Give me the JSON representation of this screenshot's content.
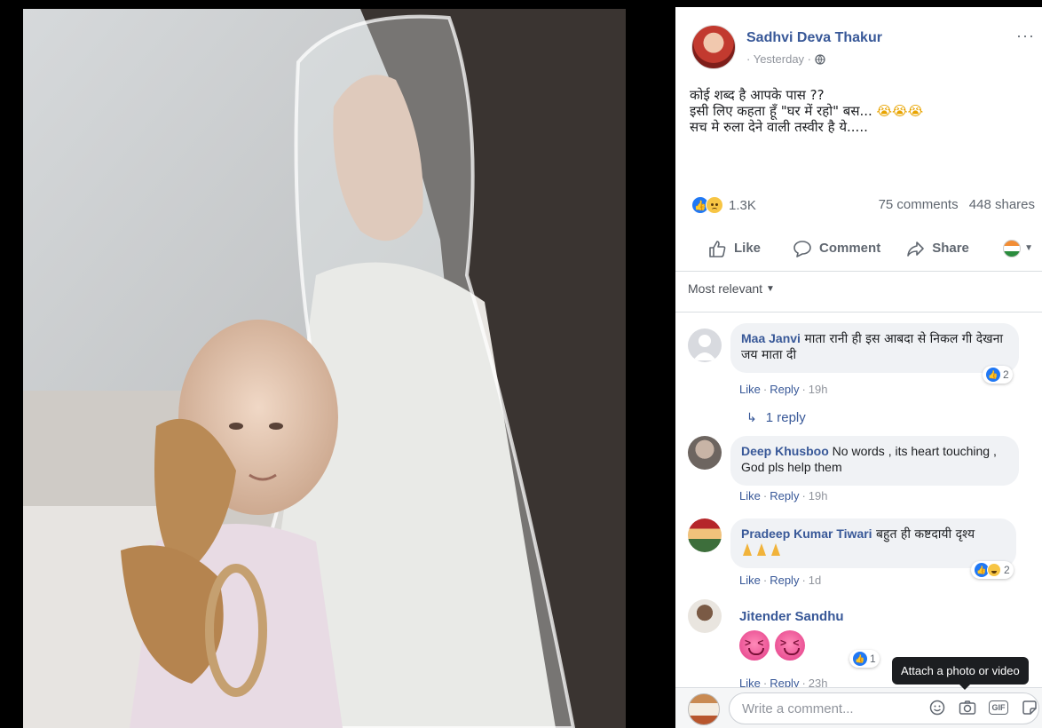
{
  "post": {
    "author": "Sadhvi Deva Thakur",
    "time": "Yesterday",
    "more": "···",
    "text_lines": [
      "कोई शब्द है आपके पास ??",
      "इसी लिए कहता हूँ \"घर में रहो\" बस...",
      "सच मे रुला देने वाली तस्वीर है ये....."
    ],
    "reaction_count": "1.3K",
    "comments_count": "75 comments",
    "shares_count": "448 shares"
  },
  "actions": {
    "like": "Like",
    "comment": "Comment",
    "share": "Share"
  },
  "sort": {
    "label": "Most relevant"
  },
  "comments": [
    {
      "author": "Maa Janvi",
      "text": "माता रानी ही इस आबदा से निकल गी देखना जय माता दी",
      "like": "Like",
      "reply": "Reply",
      "time": "19h",
      "reactions": "2",
      "replies_link": "1 reply"
    },
    {
      "author": "Deep Khusboo",
      "text": "No words , its heart touching , God pls help them",
      "like": "Like",
      "reply": "Reply",
      "time": "19h"
    },
    {
      "author": "Pradeep Kumar Tiwari",
      "text": "बहुत ही कष्टदायी दृश्य",
      "like": "Like",
      "reply": "Reply",
      "time": "1d",
      "reactions": "2"
    },
    {
      "author": "Jitender Sandhu",
      "like": "Like",
      "reply": "Reply",
      "time": "23h",
      "reactions": "1"
    }
  ],
  "composer": {
    "placeholder": "Write a comment...",
    "tooltip": "Attach a photo or video"
  },
  "icons": {
    "globe": "globe-icon",
    "like": "thumbs-up-icon",
    "comment": "speech-bubble-icon",
    "share": "share-arrow-icon",
    "emoji": "smiley-icon",
    "camera": "camera-icon",
    "gif": "gif-icon",
    "sticker": "sticker-icon"
  },
  "colors": {
    "link": "#385898",
    "like_blue": "#2078f4",
    "meta_gray": "#90949c",
    "bubble": "#f0f2f5"
  }
}
